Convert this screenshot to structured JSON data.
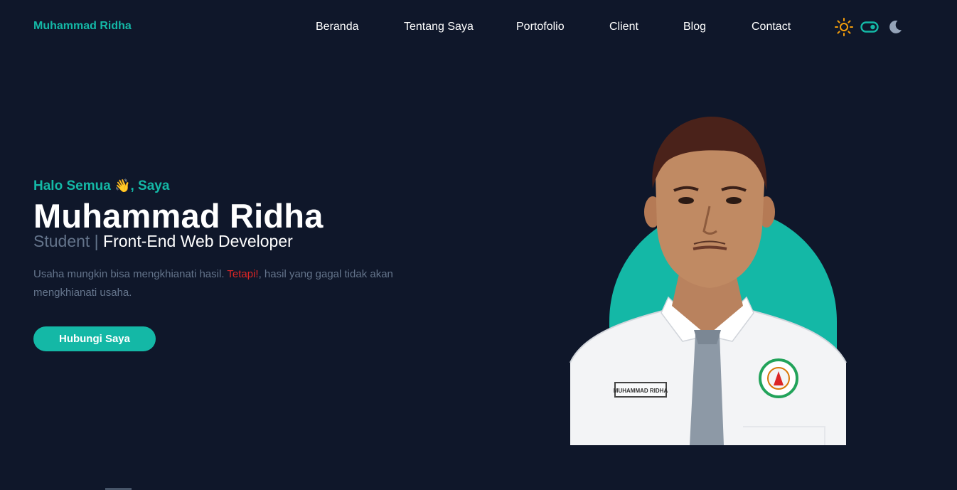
{
  "brand": {
    "name": "Muhammad Ridha"
  },
  "nav": {
    "items": [
      {
        "label": "Beranda"
      },
      {
        "label": "Tentang Saya"
      },
      {
        "label": "Portofolio"
      },
      {
        "label": "Client"
      },
      {
        "label": "Blog"
      },
      {
        "label": "Contact"
      }
    ]
  },
  "theme": {
    "icons": [
      "sun-icon",
      "toggle-switch-icon",
      "moon-icon"
    ],
    "accent": "#14b8a6",
    "sun_color": "#f59e0b"
  },
  "hero": {
    "greeting_before": "Halo Semua ",
    "greeting_emoji": "👋",
    "greeting_after": ", Saya",
    "name": "Muhammad Ridha",
    "role_muted": "Student | ",
    "role_bright": "Front-End Web Developer",
    "desc_before": "Usaha mungkin bisa mengkhianati hasil. ",
    "desc_accent": "Tetapi!",
    "desc_after": ", hasil yang gagal tidak akan mengkhianati usaha.",
    "cta_label": "Hubungi Saya",
    "name_tag": "MUHAMMAD RIDHA"
  },
  "colors": {
    "background": "#0f172a",
    "accent": "#14b8a6",
    "muted": "#64748b",
    "highlight": "#dc2626"
  }
}
